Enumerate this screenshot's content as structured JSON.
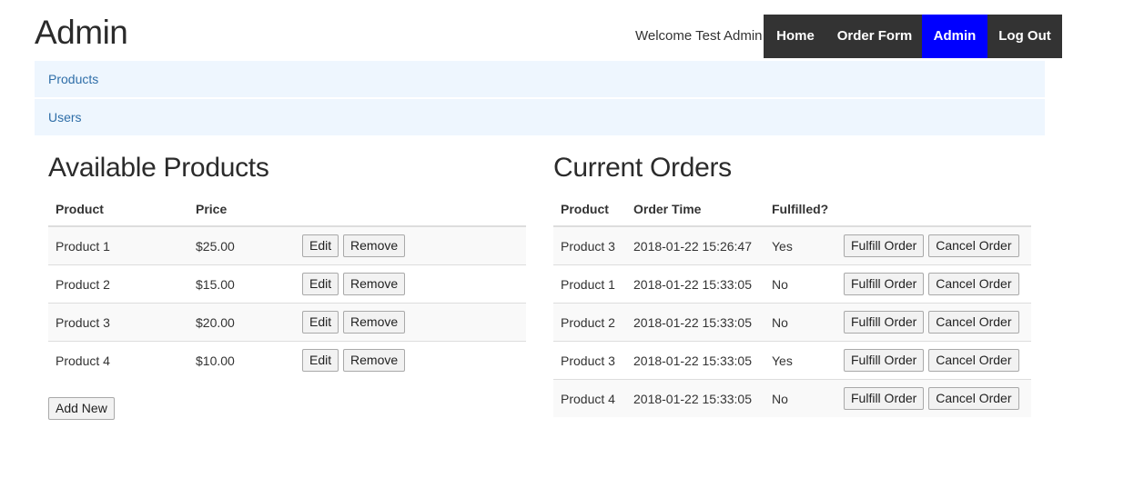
{
  "header": {
    "title": "Admin",
    "welcome": "Welcome Test Admin",
    "nav": {
      "home": "Home",
      "order_form": "Order Form",
      "admin": "Admin",
      "logout": "Log Out"
    },
    "active_color": "#0000ff",
    "nav_bg_color": "#333333"
  },
  "admin_menu": {
    "items": [
      "Products",
      "Users"
    ]
  },
  "products": {
    "title": "Available Products",
    "columns": [
      "Product",
      "Price"
    ],
    "rows": [
      {
        "name": "Product 1",
        "price": "$25.00"
      },
      {
        "name": "Product 2",
        "price": "$15.00"
      },
      {
        "name": "Product 3",
        "price": "$20.00"
      },
      {
        "name": "Product 4",
        "price": "$10.00"
      }
    ],
    "edit_label": "Edit",
    "remove_label": "Remove",
    "add_new_label": "Add New"
  },
  "orders": {
    "title": "Current Orders",
    "columns": [
      "Product",
      "Order Time",
      "Fulfilled?"
    ],
    "rows": [
      {
        "product": "Product 3",
        "time": "2018-01-22 15:26:47",
        "fulfilled": "Yes"
      },
      {
        "product": "Product 1",
        "time": "2018-01-22 15:33:05",
        "fulfilled": "No"
      },
      {
        "product": "Product 2",
        "time": "2018-01-22 15:33:05",
        "fulfilled": "No"
      },
      {
        "product": "Product 3",
        "time": "2018-01-22 15:33:05",
        "fulfilled": "Yes"
      },
      {
        "product": "Product 4",
        "time": "2018-01-22 15:33:05",
        "fulfilled": "No"
      }
    ],
    "fulfill_label": "Fulfill Order",
    "cancel_label": "Cancel Order"
  }
}
